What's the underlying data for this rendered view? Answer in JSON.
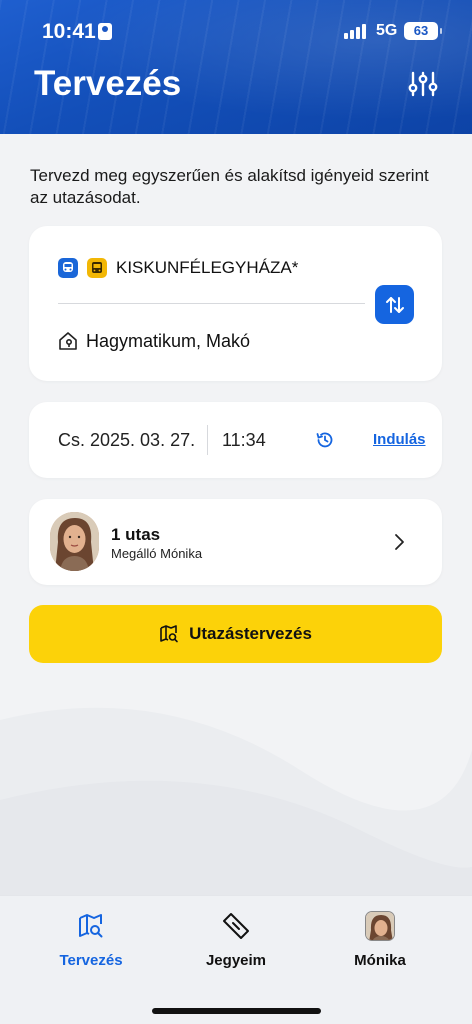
{
  "status_bar": {
    "time": "10:41",
    "network": "5G",
    "battery": "63"
  },
  "header": {
    "title": "Tervezés",
    "filter_icon": "sliders-icon"
  },
  "intro": "Tervezd meg egyszerűen és alakítsd igényeid szerint az utazásodat.",
  "route": {
    "from": "KISKUNFÉLEGYHÁZA*",
    "from_icons": [
      "train-icon",
      "bus-icon"
    ],
    "to": "Hagymatikum, Makó",
    "to_icon": "home-pin-icon",
    "swap_icon": "swap-arrows-icon"
  },
  "datetime": {
    "date": "Cs. 2025. 03. 27.",
    "time": "11:34",
    "mode": "Indulás"
  },
  "passenger": {
    "count": "1 utas",
    "name": "Megálló Mónika"
  },
  "plan_button": {
    "label": "Utazástervezés"
  },
  "tabs": [
    {
      "label": "Tervezés",
      "icon": "map-search-icon",
      "active": true
    },
    {
      "label": "Jegyeim",
      "icon": "ticket-icon",
      "active": false
    },
    {
      "label": "Mónika",
      "icon": "profile-avatar",
      "active": false
    }
  ],
  "colors": {
    "primary": "#1565e0",
    "accent": "#fcd209",
    "header": "#1a57c4"
  }
}
